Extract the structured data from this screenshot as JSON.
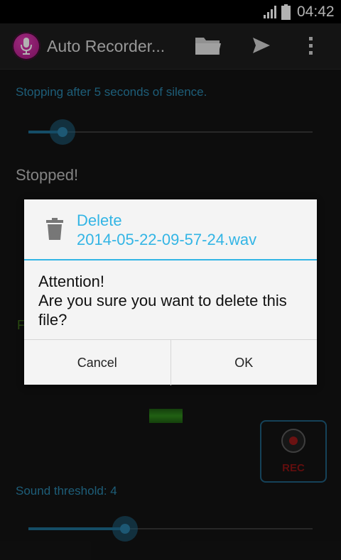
{
  "status_bar": {
    "time": "04:42",
    "signal_icon": "signal-icon",
    "battery_icon": "battery-icon"
  },
  "action_bar": {
    "title": "Auto Recorder...",
    "app_icon": "microphone-icon",
    "actions": [
      "folder-icon",
      "send-icon",
      "overflow-menu-icon"
    ]
  },
  "main": {
    "silence_text": "Stopping after 5 seconds of silence.",
    "silence_slider": {
      "value_fraction": 0.12
    },
    "status_text": "Stopped!",
    "partial_text": "F",
    "rec_label": "REC",
    "threshold_text": "Sound threshold: 4",
    "threshold_slider": {
      "value_fraction": 0.34
    }
  },
  "dialog": {
    "title": "Delete\n2014-05-22-09-57-24.wav",
    "icon": "trash-icon",
    "message": "Attention!\nAre you sure you want to delete this file?",
    "cancel_label": "Cancel",
    "ok_label": "OK"
  },
  "colors": {
    "accent": "#33b5e5",
    "rec_red": "#8b1414",
    "slider_blue": "#1f6f93"
  }
}
